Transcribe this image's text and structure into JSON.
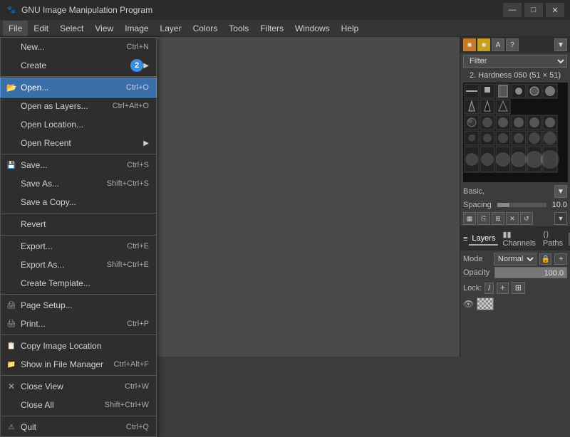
{
  "app": {
    "title": "GNU Image Manipulation Program",
    "icon": "🖼"
  },
  "titlebar": {
    "minimize": "—",
    "maximize": "□",
    "close": "✕"
  },
  "menubar": {
    "items": [
      "File",
      "Edit",
      "Select",
      "View",
      "Image",
      "Layer",
      "Colors",
      "Tools",
      "Filters",
      "Windows",
      "Help"
    ]
  },
  "file_menu": {
    "items": [
      {
        "label": "New...",
        "shortcut": "Ctrl+N",
        "icon": ""
      },
      {
        "label": "Create",
        "shortcut": "",
        "icon": "",
        "arrow": "▶",
        "separator_below": true
      },
      {
        "label": "Open...",
        "shortcut": "Ctrl+O",
        "icon": "📂",
        "highlighted": true
      },
      {
        "label": "Open as Layers...",
        "shortcut": "Ctrl+Alt+O",
        "icon": ""
      },
      {
        "label": "Open Location...",
        "shortcut": "",
        "icon": ""
      },
      {
        "label": "Open Recent",
        "shortcut": "",
        "icon": "",
        "arrow": "▶",
        "separator_below": true
      },
      {
        "label": "Save...",
        "shortcut": "Ctrl+S",
        "icon": "",
        "separator_above": true
      },
      {
        "label": "Save As...",
        "shortcut": "Shift+Ctrl+S",
        "icon": ""
      },
      {
        "label": "Save a Copy...",
        "shortcut": "",
        "icon": "",
        "separator_below": true
      },
      {
        "label": "Revert",
        "shortcut": "",
        "icon": "",
        "separator_below": true
      },
      {
        "label": "Export...",
        "shortcut": "Ctrl+E",
        "icon": "",
        "separator_above": true
      },
      {
        "label": "Export As...",
        "shortcut": "Shift+Ctrl+E",
        "icon": ""
      },
      {
        "label": "Create Template...",
        "shortcut": "",
        "icon": "",
        "separator_below": true
      },
      {
        "label": "Page Setup...",
        "shortcut": "",
        "icon": "",
        "separator_above": true
      },
      {
        "label": "Print...",
        "shortcut": "Ctrl+P",
        "icon": "",
        "separator_below": true
      },
      {
        "label": "Copy Image Location",
        "shortcut": "",
        "icon": "",
        "separator_above": true
      },
      {
        "label": "Show in File Manager",
        "shortcut": "Ctrl+Alt+F",
        "icon": "",
        "separator_below": true
      },
      {
        "label": "Close View",
        "shortcut": "Ctrl+W",
        "icon": "✕",
        "separator_above": true
      },
      {
        "label": "Close All",
        "shortcut": "Shift+Ctrl+W",
        "icon": ""
      },
      {
        "label": "Quit",
        "shortcut": "Ctrl+Q",
        "icon": "",
        "separator_above": true
      }
    ]
  },
  "brushes": {
    "filter_label": "Filter",
    "filter_placeholder": "",
    "brush_name": "2. Hardness 050 (51 × 51)",
    "basic_label": "Basic,",
    "spacing_label": "Spacing",
    "spacing_value": "10.0"
  },
  "layers": {
    "tabs": [
      "Layers",
      "Channels",
      "Paths"
    ],
    "mode_label": "Mode",
    "mode_value": "Normal",
    "opacity_label": "Opacity",
    "opacity_value": "100.0",
    "lock_label": "Lock:",
    "lock_icons": [
      "/",
      "+",
      "⊞"
    ]
  }
}
